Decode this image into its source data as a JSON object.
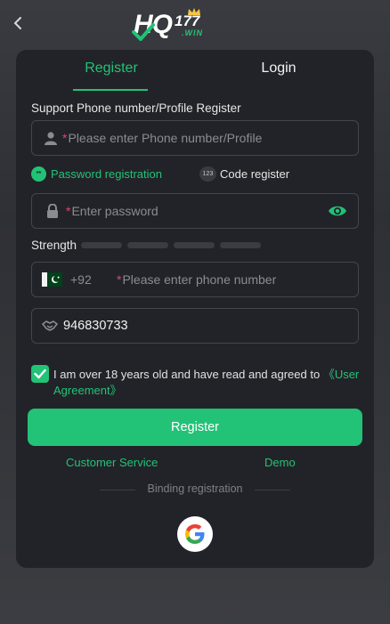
{
  "header": {
    "back_icon": "chevron-left-icon",
    "logo": {
      "text": "HQ",
      "number": "177",
      "suffix": ".WIN"
    }
  },
  "tabs": [
    {
      "label": "Register",
      "active": true
    },
    {
      "label": "Login",
      "active": false
    }
  ],
  "form": {
    "section_label": "Support Phone number/Profile Register",
    "account_input": {
      "icon": "user-icon",
      "required_mark": "*",
      "placeholder": "Please enter Phone number/Profile",
      "value": ""
    },
    "modes": {
      "password": {
        "icon_text": "**",
        "label": "Password registration",
        "active": true
      },
      "code": {
        "icon_text": "123",
        "label": "Code register",
        "active": false
      }
    },
    "password_input": {
      "icon": "lock-icon",
      "required_mark": "*",
      "placeholder": "Enter password",
      "value": "",
      "toggle_icon": "eye-icon"
    },
    "strength": {
      "label": "Strength",
      "segments": 4,
      "filled": 0
    },
    "phone_input": {
      "flag": "pakistan-flag-icon",
      "country_code": "+92",
      "required_mark": "*",
      "placeholder": "Please enter phone number",
      "value": ""
    },
    "invite_input": {
      "icon": "handshake-icon",
      "value": "946830733"
    },
    "agreement": {
      "checked": true,
      "text": "I am over 18 years old and have read and agreed to ",
      "link": "《User Agreement》"
    },
    "submit_label": "Register"
  },
  "links": {
    "customer_service": "Customer Service",
    "demo": "Demo"
  },
  "binding": {
    "label": "Binding registration",
    "providers": [
      "google-icon"
    ]
  },
  "colors": {
    "accent": "#22c277",
    "card": "#222328",
    "background": "#2f3035",
    "required": "#e0456b"
  }
}
